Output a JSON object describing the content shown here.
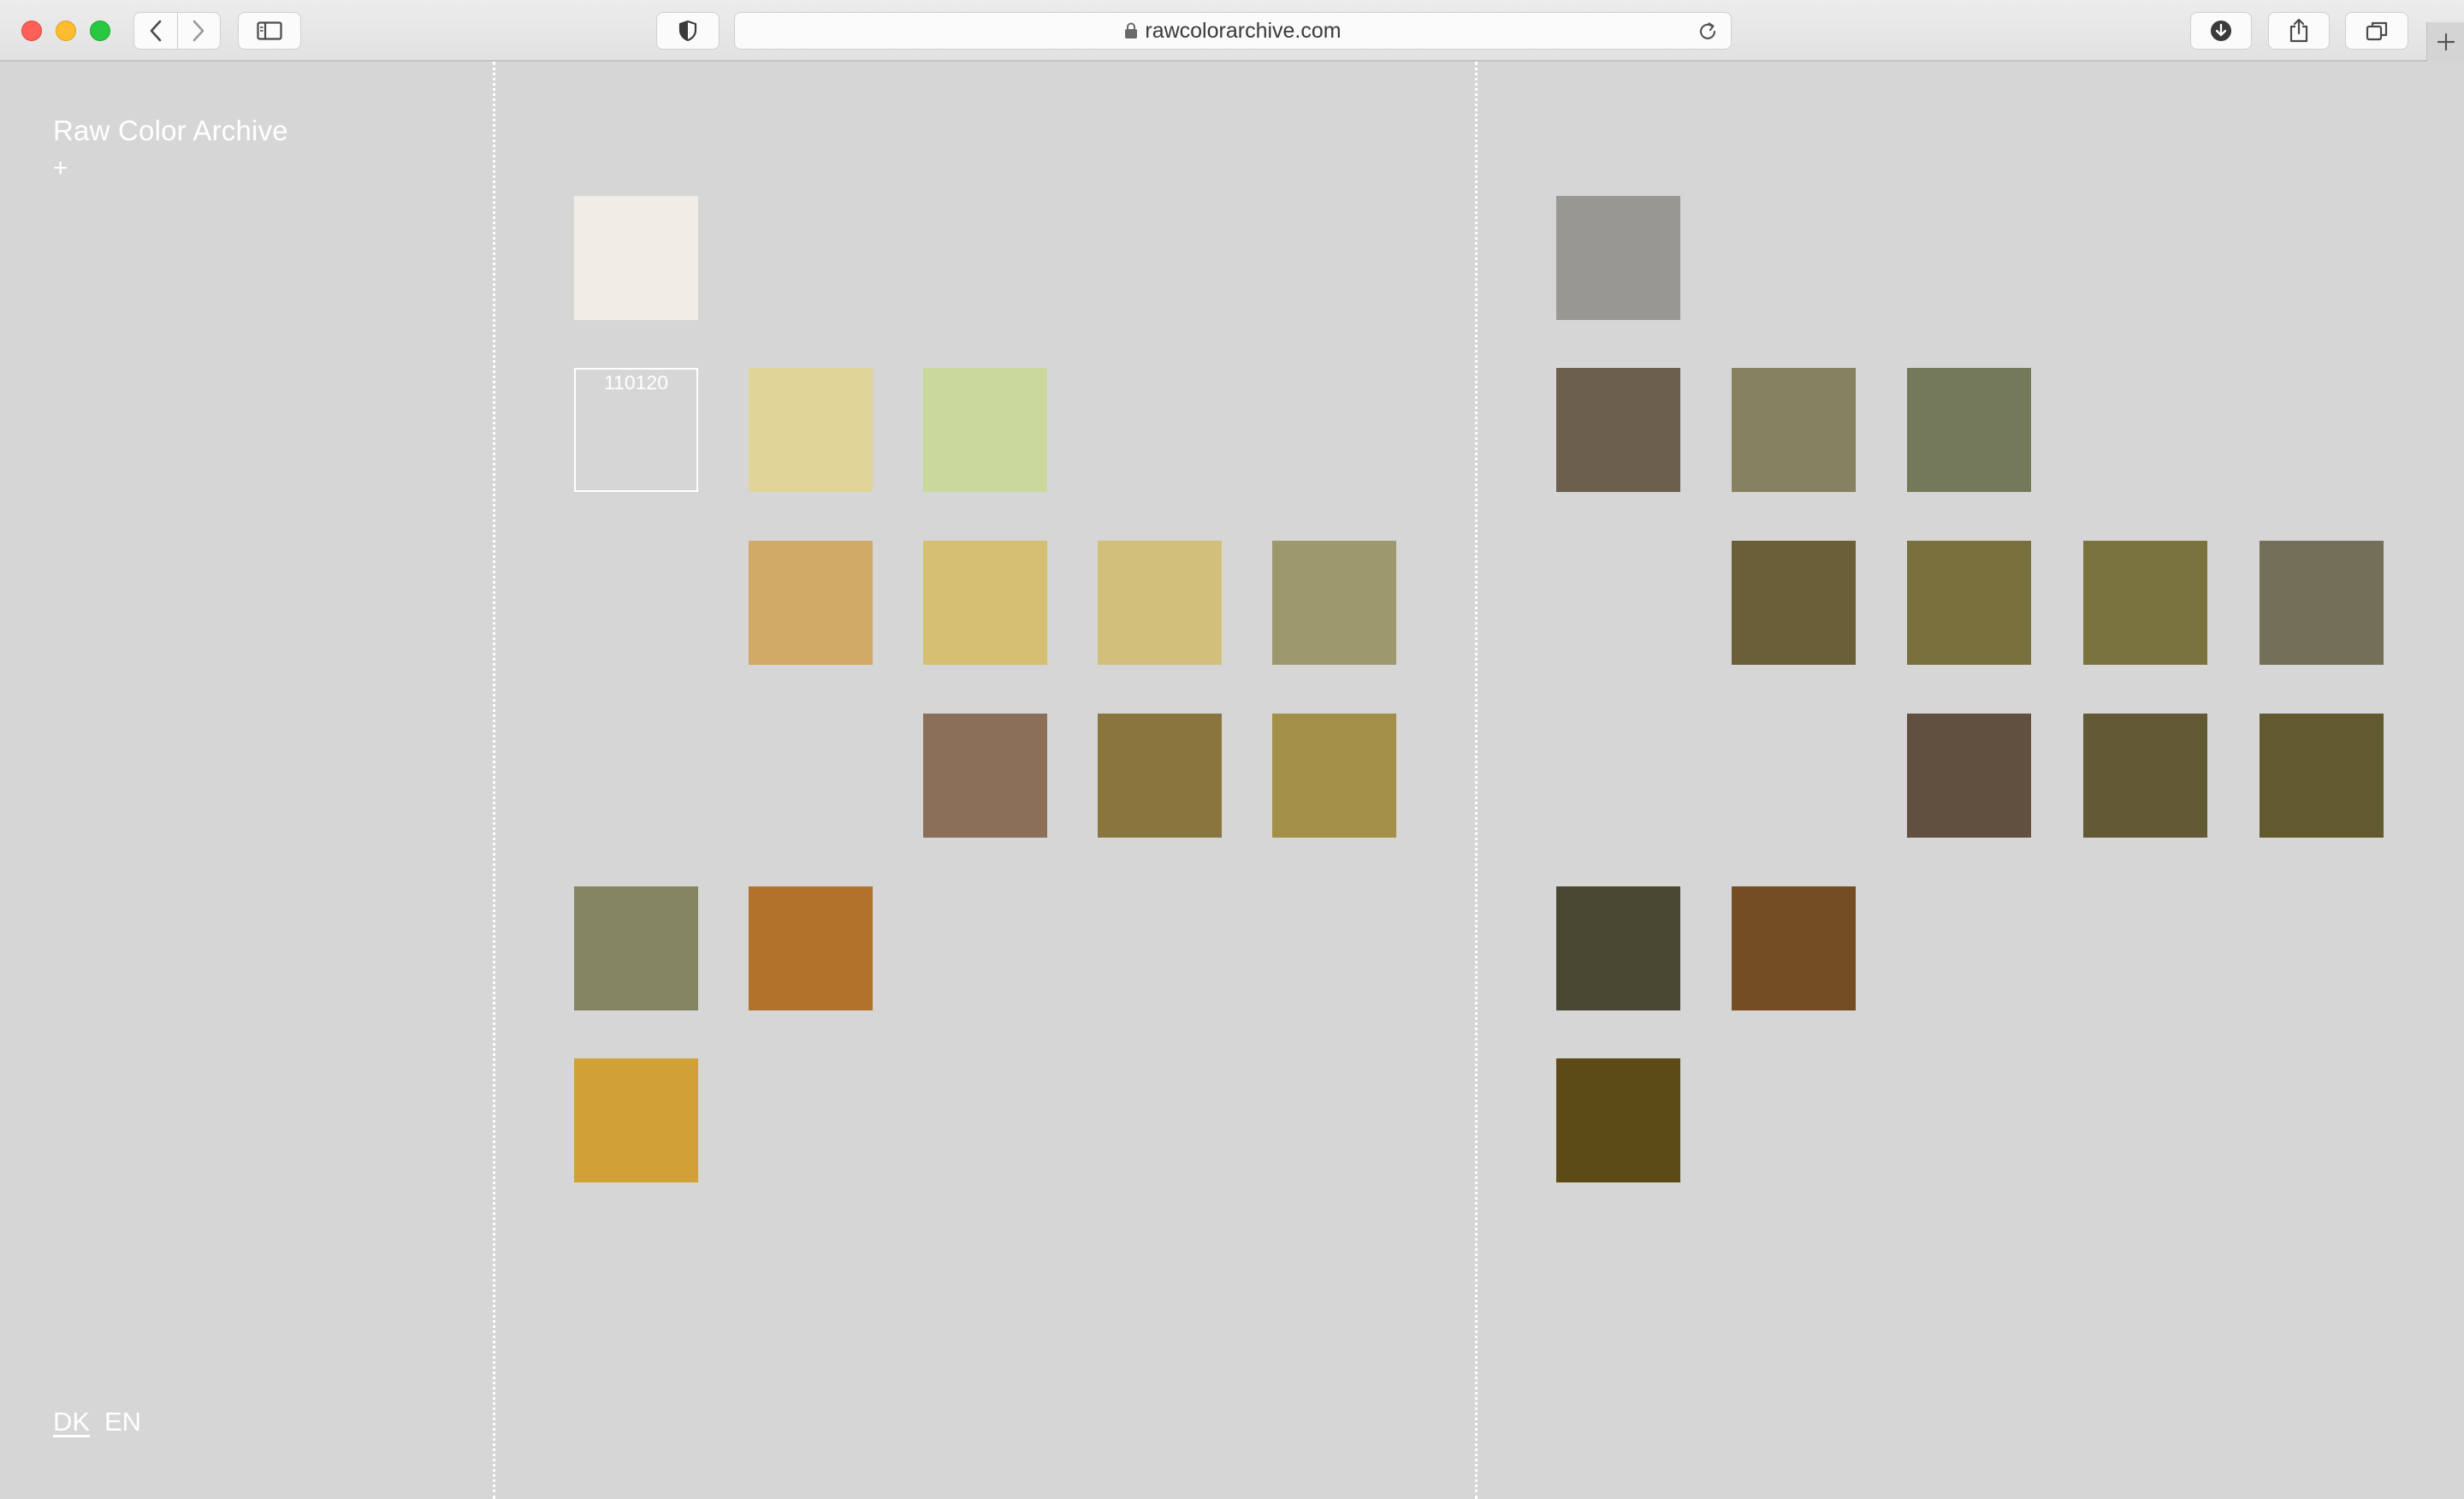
{
  "browser": {
    "url": "rawcolorarchive.com"
  },
  "site": {
    "title": "Raw Color Archive",
    "plus": "+",
    "languages": {
      "dk": "DK",
      "en": "EN"
    }
  },
  "swatches": {
    "left": [
      {
        "color": "#f0ece6"
      },
      {
        "color": "none",
        "code": "110120"
      },
      {
        "color": "#e1d498"
      },
      {
        "color": "#cad89b"
      },
      {
        "color": "#d2aa67"
      },
      {
        "color": "#d5bf71"
      },
      {
        "color": "#d3bf7c"
      },
      {
        "color": "#9d986e"
      },
      {
        "color": "#8b6f58"
      },
      {
        "color": "#8a753f"
      },
      {
        "color": "#a48f48"
      },
      {
        "color": "#838660"
      },
      {
        "color": "#b2722b"
      },
      {
        "color": "#d1a137"
      }
    ],
    "right": [
      {
        "color": "#989793"
      },
      {
        "color": "#6b5f4e"
      },
      {
        "color": "#868261"
      },
      {
        "color": "#75795b"
      },
      {
        "color": "#6a5f38"
      },
      {
        "color": "#79703d"
      },
      {
        "color": "#7b733e"
      },
      {
        "color": "#737057"
      },
      {
        "color": "#614f40"
      },
      {
        "color": "#625a34"
      },
      {
        "color": "#605a2e"
      },
      {
        "color": "#494732"
      },
      {
        "color": "#754d22"
      },
      {
        "color": "#5c4b16"
      }
    ]
  }
}
